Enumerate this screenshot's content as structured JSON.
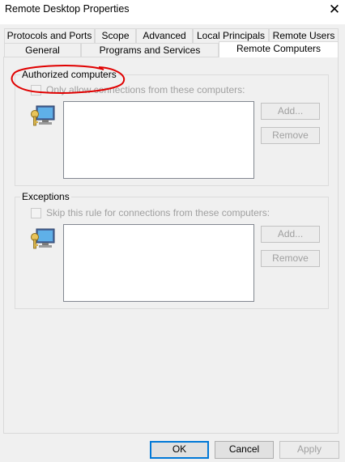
{
  "window": {
    "title": "Remote Desktop Properties",
    "close_glyph": "✕"
  },
  "tabs_row1": [
    "Protocols and Ports",
    "Scope",
    "Advanced",
    "Local Principals",
    "Remote Users"
  ],
  "tabs_row2": [
    "General",
    "Programs and Services",
    "Remote Computers"
  ],
  "active_tab": "Remote Computers",
  "authorized": {
    "group_label": "Authorized computers",
    "checkbox_label": "Only allow connections from these computers:",
    "checked": false,
    "add_label": "Add...",
    "remove_label": "Remove"
  },
  "exceptions": {
    "group_label": "Exceptions",
    "checkbox_label": "Skip this rule for connections from these computers:",
    "checked": false,
    "add_label": "Add...",
    "remove_label": "Remove"
  },
  "footer": {
    "ok_label": "OK",
    "cancel_label": "Cancel",
    "apply_label": "Apply"
  },
  "colors": {
    "annotation_circle": "#e00000",
    "focus_border": "#0078d7"
  },
  "icons": [
    "close-icon",
    "computer-key-icon"
  ]
}
